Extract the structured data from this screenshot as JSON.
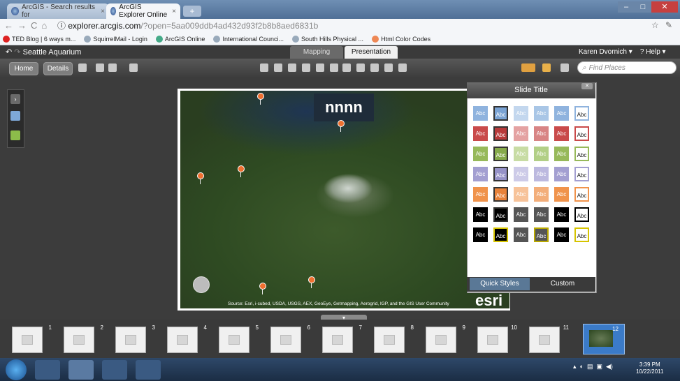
{
  "browser": {
    "tabs": [
      {
        "label": "ArcGIS - Search results for"
      },
      {
        "label": "ArcGIS Explorer Online"
      }
    ],
    "url_domain": "explorer.arcgis.com",
    "url_rest": "/?open=5aa009ddb4ad432d93f2b8b8aed6831b",
    "bookmarks": [
      {
        "label": "TED Blog | 6 ways m..."
      },
      {
        "label": "SquirrelMail - Login"
      },
      {
        "label": "ArcGIS Online"
      },
      {
        "label": "International Counci..."
      },
      {
        "label": "South Hills Physical ..."
      },
      {
        "label": "Html Color Codes"
      }
    ]
  },
  "app": {
    "title": "Seattle Aquarium",
    "mode_tabs": {
      "mapping": "Mapping",
      "presentation": "Presentation"
    },
    "user": "Karen Dvornich",
    "help": "Help",
    "home": "Home",
    "details": "Details",
    "search_placeholder": "Find Places"
  },
  "slide": {
    "title": "nnnn",
    "attribution": "Source: Esri, i-cubed, USDA, USGS, AEX, GeoEye, Getmapping, Aerogrid, IGP, and the GIS User Community",
    "logo": "esri"
  },
  "style_panel": {
    "title": "Slide Title",
    "swatch_label": "Abc",
    "tabs": {
      "quick": "Quick Styles",
      "custom": "Custom"
    },
    "rows": [
      [
        "#8fb3de",
        "#7aa3d4",
        "#c3d7ee",
        "#a9c6e6",
        "#8fb3de",
        "#ffffff"
      ],
      [
        "#c94a4a",
        "#b83a3a",
        "#e4a2a2",
        "#d88484",
        "#c94a4a",
        "#ffffff"
      ],
      [
        "#97b95a",
        "#86aa4a",
        "#c8dca4",
        "#b2cf86",
        "#97b95a",
        "#ffffff"
      ],
      [
        "#a39fd1",
        "#9692c8",
        "#cdcbe8",
        "#bcb9df",
        "#a39fd1",
        "#ffffff"
      ],
      [
        "#f0934b",
        "#e8823a",
        "#f7c39a",
        "#f3ae7a",
        "#f0934b",
        "#ffffff"
      ],
      [
        "#000000",
        "#000000",
        "#555555",
        "#555555",
        "#000000",
        "#ffffff"
      ],
      [
        "#000000",
        "#000000",
        "#555555",
        "#555555",
        "#000000",
        "#ffffff"
      ]
    ]
  },
  "filmstrip": {
    "slides": [
      "1",
      "2",
      "3",
      "4",
      "5",
      "6",
      "7",
      "8",
      "9",
      "10",
      "11",
      "12"
    ],
    "selected": "12"
  },
  "taskbar": {
    "time": "3:39 PM",
    "date": "10/22/2011"
  }
}
